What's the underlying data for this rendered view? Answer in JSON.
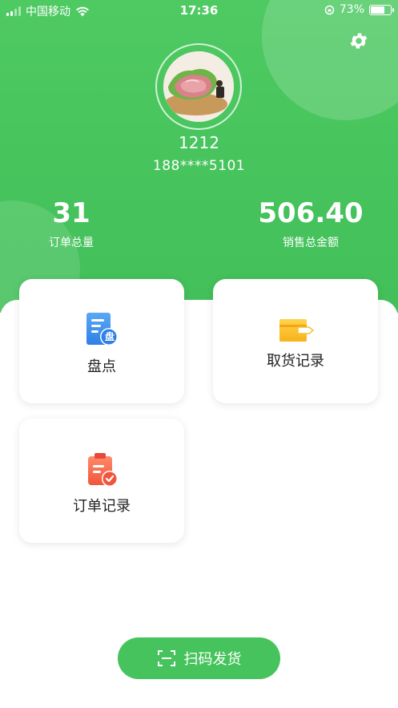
{
  "status_bar": {
    "carrier": "中国移动",
    "time": "17:36",
    "battery_percent": "73%",
    "battery_level": 0.73
  },
  "profile": {
    "name": "1212",
    "phone": "188****5101"
  },
  "stats": [
    {
      "value": "31",
      "label": "订单总量"
    },
    {
      "value": "506.40",
      "label": "销售总金额"
    }
  ],
  "menu": [
    {
      "label": "盘点",
      "icon": "inventory-icon",
      "icon_char": "盘"
    },
    {
      "label": "取货记录",
      "icon": "card-icon"
    },
    {
      "label": "订单记录",
      "icon": "clipboard-check-icon"
    }
  ],
  "scan_button": {
    "label": "扫码发货",
    "icon": "scan-icon"
  },
  "colors": {
    "primary_green": "#46c35c",
    "header_green": "#4fca63"
  }
}
